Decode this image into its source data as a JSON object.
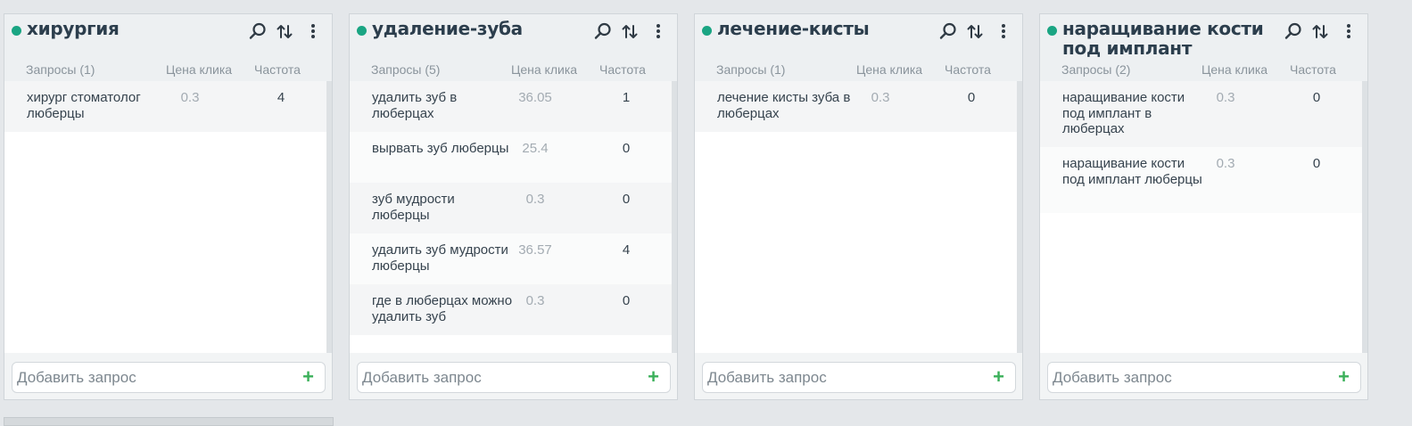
{
  "colors": {
    "accent": "#1aa583",
    "plus": "#3bb05a"
  },
  "icons": {
    "search": "search-icon",
    "sort": "sort-icon",
    "more": "more-vertical-icon",
    "add": "plus-icon"
  },
  "columns": [
    {
      "title": "хирургия",
      "hdr_queries": "Запросы (1)",
      "hdr_price": "Цена клика",
      "hdr_freq": "Частота",
      "rows": [
        {
          "query": "хирург стоматолог люберцы",
          "price": "0.3",
          "freq": "4"
        }
      ],
      "add_placeholder": "Добавить запрос",
      "add_icon": "+"
    },
    {
      "title": "удаление-зуба",
      "hdr_queries": "Запросы (5)",
      "hdr_price": "Цена клика",
      "hdr_freq": "Частота",
      "rows": [
        {
          "query": "удалить зуб в люберцах",
          "price": "36.05",
          "freq": "1"
        },
        {
          "query": "вырвать зуб люберцы",
          "price": "25.4",
          "freq": "0"
        },
        {
          "query": "зуб мудрости люберцы",
          "price": "0.3",
          "freq": "0"
        },
        {
          "query": "удалить зуб мудрости люберцы",
          "price": "36.57",
          "freq": "4"
        },
        {
          "query": "где в люберцах можно удалить зуб",
          "price": "0.3",
          "freq": "0"
        }
      ],
      "add_placeholder": "Добавить запрос",
      "add_icon": "+"
    },
    {
      "title": "лечение-кисты",
      "hdr_queries": "Запросы (1)",
      "hdr_price": "Цена клика",
      "hdr_freq": "Частота",
      "rows": [
        {
          "query": "лечение кисты зуба в люберцах",
          "price": "0.3",
          "freq": "0"
        }
      ],
      "add_placeholder": "Добавить запрос",
      "add_icon": "+"
    },
    {
      "title": "наращивание кости под имплант",
      "hdr_queries": "Запросы (2)",
      "hdr_price": "Цена клика",
      "hdr_freq": "Частота",
      "rows": [
        {
          "query": "наращивание кости под имплант в люберцах",
          "price": "0.3",
          "freq": "0"
        },
        {
          "query": "наращивание кости под имплант люберцы",
          "price": "0.3",
          "freq": "0"
        }
      ],
      "add_placeholder": "Добавить запрос",
      "add_icon": "+"
    }
  ]
}
